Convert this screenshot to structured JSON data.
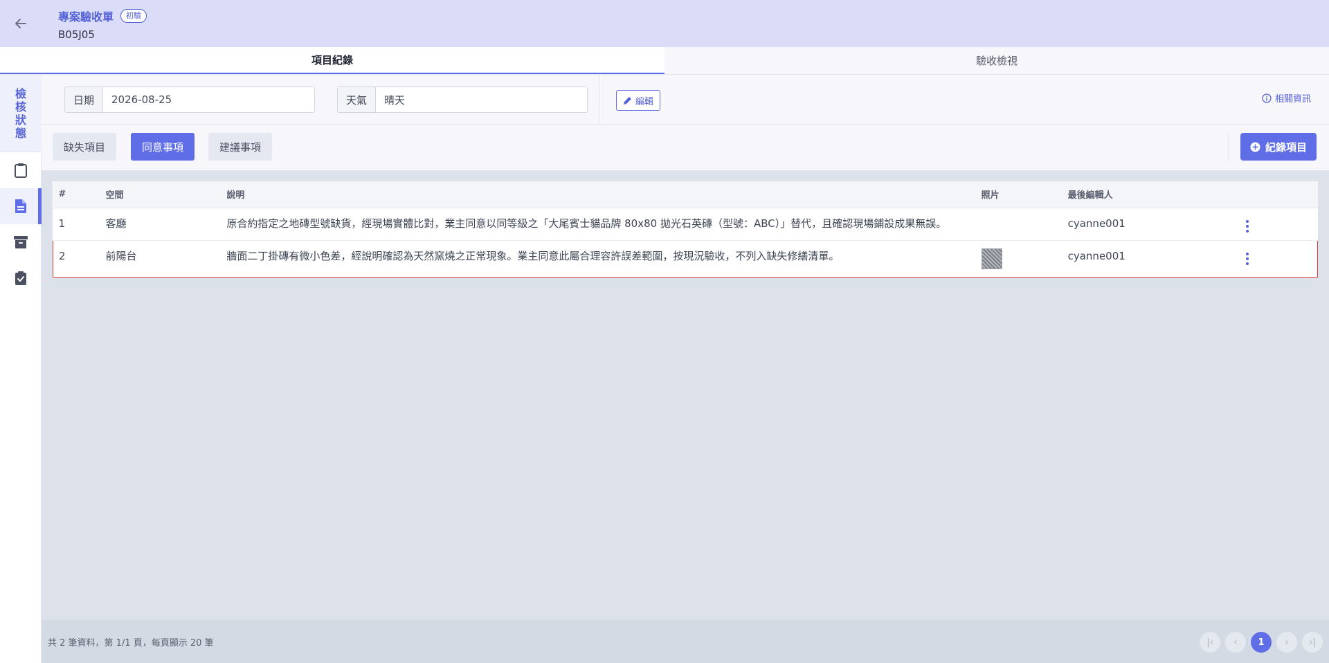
{
  "header": {
    "title": "專案驗收單",
    "badge": "初驗",
    "project_code": "B05J05"
  },
  "tabs": [
    {
      "label": "項目紀錄",
      "active": true
    },
    {
      "label": "驗收檢視",
      "active": false
    }
  ],
  "sidebar": {
    "status_label": [
      "檢",
      "核",
      "狀",
      "態"
    ],
    "items": [
      {
        "icon": "clipboard-icon",
        "active": false
      },
      {
        "icon": "document-icon",
        "active": true
      },
      {
        "icon": "archive-icon",
        "active": false
      },
      {
        "icon": "clipboard-check-icon",
        "active": false
      }
    ]
  },
  "filters": {
    "date_label": "日期",
    "date_value": "2026-08-25",
    "weather_label": "天氣",
    "weather_value": "晴天",
    "edit_label": "編輯",
    "info_label": "相關資訊"
  },
  "categories": [
    {
      "label": "缺失項目",
      "active": false
    },
    {
      "label": "同意事項",
      "active": true
    },
    {
      "label": "建議事項",
      "active": false
    }
  ],
  "add_button_label": "紀錄項目",
  "table": {
    "headers": {
      "index": "#",
      "space": "空間",
      "description": "說明",
      "photo": "照片",
      "editor": "最後編輯人"
    },
    "rows": [
      {
        "index": "1",
        "space": "客廳",
        "description": "原合約指定之地磚型號缺貨，經現場實體比對，業主同意以同等級之「大尾賓士貓品牌 80x80 拋光石英磚（型號：ABC）」替代，且確認現場鋪設成果無誤。",
        "has_photo": false,
        "editor": "cyanne001"
      },
      {
        "index": "2",
        "space": "前陽台",
        "description": "牆面二丁掛磚有微小色差，經說明確認為天然窯燒之正常現象。業主同意此屬合理容許誤差範圍，按現況驗收，不列入缺失修繕清單。",
        "has_photo": true,
        "editor": "cyanne001"
      }
    ]
  },
  "footer": {
    "summary": "共 2 筆資料，第 1/1 頁，每頁顯示 20 筆",
    "current_page": "1"
  },
  "colors": {
    "accent": "#5f6ee6",
    "header_bg": "#dadcf8",
    "selected_row_border": "#e53935"
  }
}
